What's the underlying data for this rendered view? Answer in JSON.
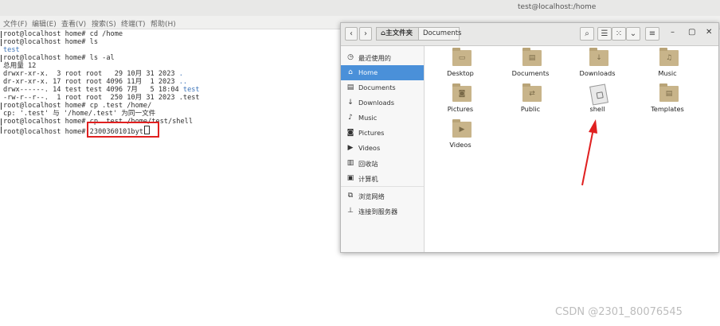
{
  "terminal": {
    "title": "test@localhost:/home",
    "menu": [
      "文件(F)",
      "编辑(E)",
      "查看(V)",
      "搜索(S)",
      "终端(T)",
      "帮助(H)"
    ],
    "lines": [
      {
        "prompt": true,
        "text": "root@localhost home# cd /home"
      },
      {
        "prompt": true,
        "text": "root@localhost home# ls"
      },
      {
        "prompt": false,
        "text": "test"
      },
      {
        "prompt": true,
        "text": "root@localhost home# ls -al"
      },
      {
        "prompt": false,
        "text": "总用量 12"
      },
      {
        "prompt": false,
        "text": "drwxr-xr-x.  3 root root   29 10月 31 2023 ."
      },
      {
        "prompt": false,
        "text": "dr-xr-xr-x. 17 root root 4096 11月  1 2023 .."
      },
      {
        "prompt": false,
        "text": "drwx------. 14 test test 4096 7月   5 18:04 test"
      },
      {
        "prompt": false,
        "text": "-rw-r--r--.  1 root root  250 10月 31 2023 .test"
      },
      {
        "prompt": true,
        "text": "root@localhost home# cp .test /home/"
      },
      {
        "prompt": false,
        "text": "cp: '.test' 与 '/home/.test' 为同一文件"
      },
      {
        "prompt": true,
        "text": "root@localhost home# cp .test /home/test/shell"
      },
      {
        "prompt": true,
        "text": "root@localhost home# 2300360101byt"
      }
    ]
  },
  "file_manager": {
    "breadcrumb": [
      "主文件夹",
      "Documents"
    ],
    "window_controls": [
      "–",
      "▢",
      "✕"
    ],
    "sidebar": [
      {
        "label": "最近使用的",
        "icon": "clock-icon",
        "glyph": "◷"
      },
      {
        "label": "Home",
        "icon": "home-icon",
        "glyph": "⌂",
        "active": true
      },
      {
        "label": "Documents",
        "icon": "document-icon",
        "glyph": "▤"
      },
      {
        "label": "Downloads",
        "icon": "download-icon",
        "glyph": "↓"
      },
      {
        "label": "Music",
        "icon": "music-icon",
        "glyph": "♪"
      },
      {
        "label": "Pictures",
        "icon": "camera-icon",
        "glyph": "◙"
      },
      {
        "label": "Videos",
        "icon": "video-icon",
        "glyph": "▶"
      },
      {
        "label": "回收站",
        "icon": "trash-icon",
        "glyph": "▥"
      },
      {
        "label": "计算机",
        "icon": "computer-icon",
        "glyph": "▣"
      },
      {
        "label": "浏览网络",
        "icon": "network-icon",
        "glyph": "⧉"
      },
      {
        "label": "连接到服务器",
        "icon": "server-icon",
        "glyph": "⊥"
      }
    ],
    "files": [
      {
        "label": "Desktop",
        "icon": "desktop-folder-icon",
        "glyph": "▭"
      },
      {
        "label": "Documents",
        "icon": "documents-folder-icon",
        "glyph": "▤"
      },
      {
        "label": "Downloads",
        "icon": "downloads-folder-icon",
        "glyph": "↓"
      },
      {
        "label": "Music",
        "icon": "music-folder-icon",
        "glyph": "♫"
      },
      {
        "label": "Pictures",
        "icon": "pictures-folder-icon",
        "glyph": "◙"
      },
      {
        "label": "Public",
        "icon": "public-folder-icon",
        "glyph": "⇄"
      },
      {
        "label": "shell",
        "icon": "shell-file-icon",
        "type": "file"
      },
      {
        "label": "Templates",
        "icon": "templates-folder-icon",
        "glyph": "▤"
      },
      {
        "label": "Videos",
        "icon": "videos-folder-icon",
        "glyph": "▶"
      }
    ]
  },
  "watermark": "CSDN @2301_80076545",
  "colors": {
    "accent": "#4a90d9",
    "highlight_red": "#e02020",
    "terminal_link": "#3b73b9"
  }
}
